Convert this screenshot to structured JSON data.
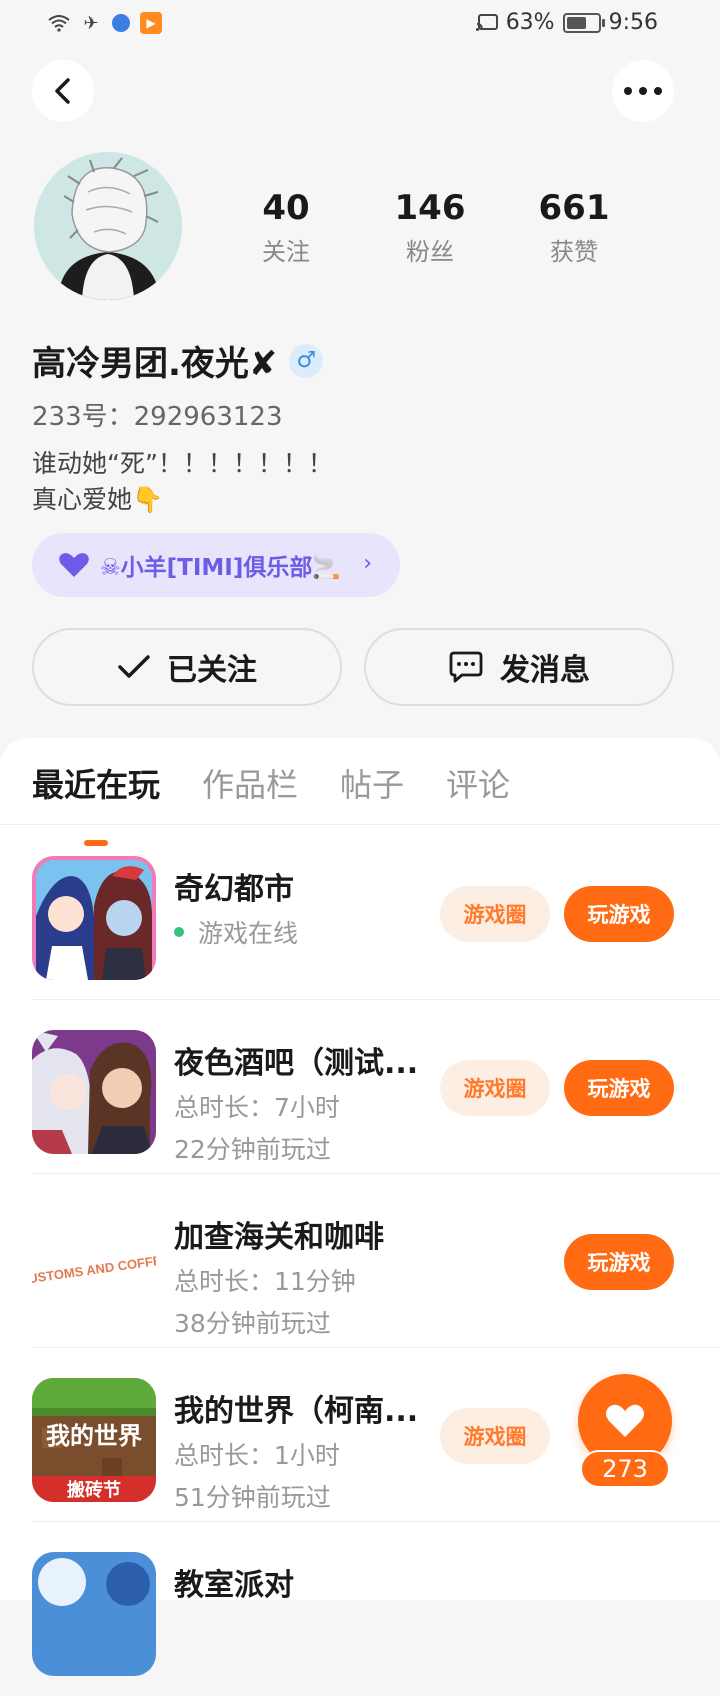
{
  "status_bar": {
    "battery": "63%",
    "time": "9:56",
    "battery_level": 0.63
  },
  "profile": {
    "stats": [
      {
        "value": "40",
        "label": "关注"
      },
      {
        "value": "146",
        "label": "粉丝"
      },
      {
        "value": "661",
        "label": "获赞"
      }
    ],
    "name": "高冷男团.夜光✘",
    "gender_symbol": "♂",
    "uid": "233号：292963123",
    "bio_line1": "谁动她“死”！！！！！！！",
    "bio_line2": "真心爱她👇",
    "club": "☠小羊[TIMI]俱乐部🚬",
    "follow_label": "已关注",
    "message_label": "发消息"
  },
  "tabs": [
    {
      "label": "最近在玩",
      "active": true
    },
    {
      "label": "作品栏",
      "active": false
    },
    {
      "label": "帖子",
      "active": false
    },
    {
      "label": "评论",
      "active": false
    }
  ],
  "games": [
    {
      "title": "奇幻都市",
      "online": "游戏在线",
      "circle": "游戏圈",
      "play": "玩游戏"
    },
    {
      "title": "夜色酒吧（测试...",
      "duration": "总时长：7小时",
      "last_played": "22分钟前玩过",
      "circle": "游戏圈",
      "play": "玩游戏"
    },
    {
      "title": "加查海关和咖啡",
      "duration": "总时长：11分钟",
      "last_played": "38分钟前玩过",
      "play": "玩游戏",
      "icon_text": "CUSTOMS AND COFFEE"
    },
    {
      "title": "我的世界（柯南...",
      "duration": "总时长：1小时",
      "last_played": "51分钟前玩过",
      "circle": "游戏圈",
      "icon_text_top": "我的世界",
      "icon_text_bottom": "搬砖节"
    },
    {
      "title": "教室派对"
    }
  ],
  "likes": {
    "count": "273"
  },
  "colors": {
    "accent": "#ff6a13",
    "online": "#35c27a",
    "club": "#6c5ce7"
  }
}
